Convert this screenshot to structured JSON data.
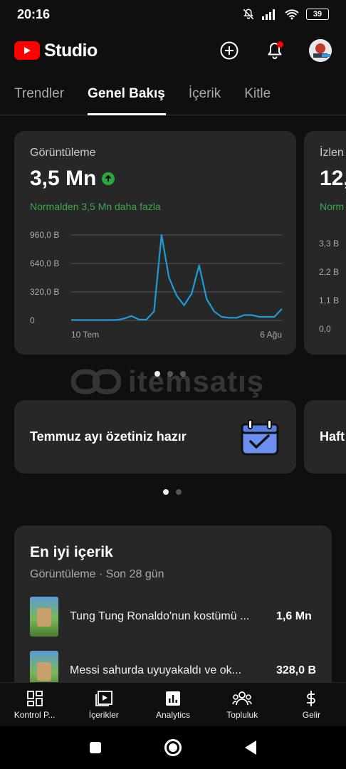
{
  "status_bar": {
    "time": "20:16",
    "battery": "39"
  },
  "app": {
    "logo_text": "Studio"
  },
  "tabs": [
    {
      "label": "Trendler",
      "active": false
    },
    {
      "label": "Genel Bakış",
      "active": true
    },
    {
      "label": "İçerik",
      "active": false
    },
    {
      "label": "Kitle",
      "active": false
    }
  ],
  "metric": {
    "label": "Görüntüleme",
    "value": "3,5 Mn",
    "note": "Normalden 3,5 Mn daha fazla"
  },
  "metric_peek": {
    "label": "İzlen",
    "value": "12,",
    "note": "Norm",
    "ticks": [
      "3,3 B",
      "2,2 B",
      "1,1 B",
      "0,0"
    ]
  },
  "chart_data": {
    "type": "line",
    "y_tick_labels": [
      "960,0 B",
      "640,0 B",
      "320,0 B",
      "0"
    ],
    "x_tick_labels": [
      "10 Tem",
      "6 Ağu"
    ],
    "ylim": [
      0,
      960000
    ],
    "grid": true,
    "series": [
      {
        "color": "#1e9ad6",
        "values": [
          5000,
          4000,
          4000,
          4000,
          4000,
          4000,
          5000,
          20000,
          50000,
          10000,
          10000,
          100000,
          960000,
          480000,
          280000,
          170000,
          300000,
          620000,
          240000,
          100000,
          40000,
          30000,
          30000,
          60000,
          60000,
          40000,
          40000,
          40000,
          130000
        ]
      }
    ]
  },
  "summary_card": {
    "title": "Temmuz ayı özetiniz hazır",
    "peek": "Haft"
  },
  "watermark": {
    "text": "itemsatış"
  },
  "top_content": {
    "title": "En iyi içerik",
    "subtitle": "Görüntüleme · Son 28 gün",
    "rows": [
      {
        "title": "Tung Tung Ronaldo'nun kostümü ...",
        "value": "1,6 Mn"
      },
      {
        "title": "Messi sahurda uyuyakaldı ve ok...",
        "value": "328,0 B"
      }
    ]
  },
  "bottom_nav": [
    {
      "label": "Kontrol P...",
      "icon": "dashboard-icon"
    },
    {
      "label": "İçerikler",
      "icon": "content-icon"
    },
    {
      "label": "Analytics",
      "icon": "analytics-icon"
    },
    {
      "label": "Topluluk",
      "icon": "community-icon"
    },
    {
      "label": "Gelir",
      "icon": "earn-icon"
    }
  ],
  "colors": {
    "accent": "#ff0000",
    "positive": "#3ea74d",
    "line": "#1e9ad6",
    "card": "#272727"
  }
}
